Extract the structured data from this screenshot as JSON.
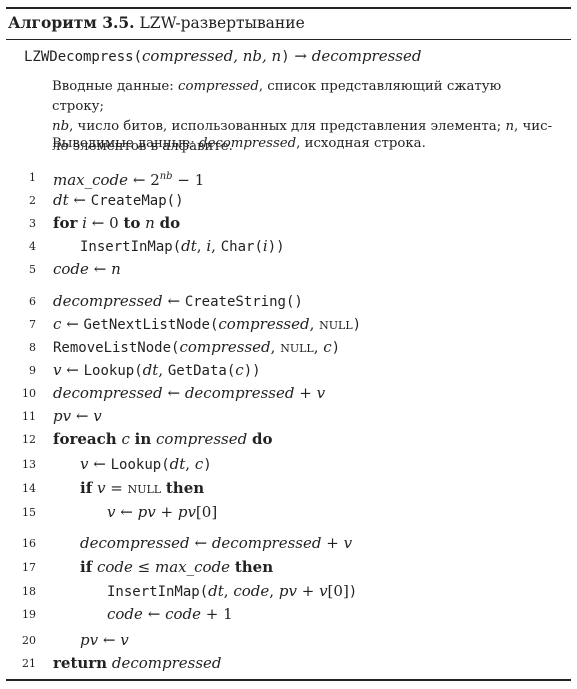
{
  "title": {
    "label": "Алгоритм 3.5.",
    "name": "LZW-развертывание"
  },
  "signature": {
    "func": "LZWDecompress",
    "params": "compressed, nb, n",
    "arrow": "→",
    "ret": "decompressed"
  },
  "input": {
    "label": "Вводные данные:",
    "p1": "compressed",
    "t1": ", список представляющий сжатую строку;",
    "p2": "nb",
    "t2": ", число битов, использованных для представления элемента;",
    "p3": "n",
    "t3": ", чис-",
    "t4": "ло элементов в алфавите."
  },
  "output": {
    "label": "Выводимые данные:",
    "p1": "decompressed",
    "t1": ", исходная строка."
  },
  "lines": [
    {
      "num": "1"
    },
    {
      "num": "2"
    },
    {
      "num": "3"
    },
    {
      "num": "4"
    },
    {
      "num": "5"
    },
    {
      "num": "6"
    },
    {
      "num": "7"
    },
    {
      "num": "8"
    },
    {
      "num": "9"
    },
    {
      "num": "10"
    },
    {
      "num": "11"
    },
    {
      "num": "12"
    },
    {
      "num": "13"
    },
    {
      "num": "14"
    },
    {
      "num": "15"
    },
    {
      "num": "16"
    },
    {
      "num": "17"
    },
    {
      "num": "18"
    },
    {
      "num": "19"
    },
    {
      "num": "20"
    },
    {
      "num": "21"
    }
  ],
  "tokens": {
    "max_code": "max_code",
    "larrow": "←",
    "two": "2",
    "nb": "nb",
    "minus_one": "− 1",
    "dt": "dt",
    "create_map": "CreateMap()",
    "kw_for": "for",
    "i": "i",
    "zero": "0",
    "kw_to": "to",
    "n": "n",
    "kw_do": "do",
    "insert_in_map": "InsertInMap(",
    "char_open": "Char(",
    "close": ")",
    "close_paren_space": ")",
    "comma": ",",
    "code": "code",
    "decompressed": "decompressed",
    "create_string": "CreateString()",
    "c": "c",
    "get_next_list_node": "GetNextListNode(",
    "compressed": "compressed",
    "null": "null",
    "remove_list_node": "RemoveListNode(",
    "v": "v",
    "lookup": "Lookup(",
    "get_data": "GetData(",
    "plus": "+",
    "pv": "pv",
    "kw_foreach": "foreach",
    "kw_in": "in",
    "kw_if": "if",
    "eq": "=",
    "kw_then": "then",
    "idx0": "[0]",
    "le": "≤",
    "plus_one": "+ 1",
    "kw_return": "return"
  }
}
